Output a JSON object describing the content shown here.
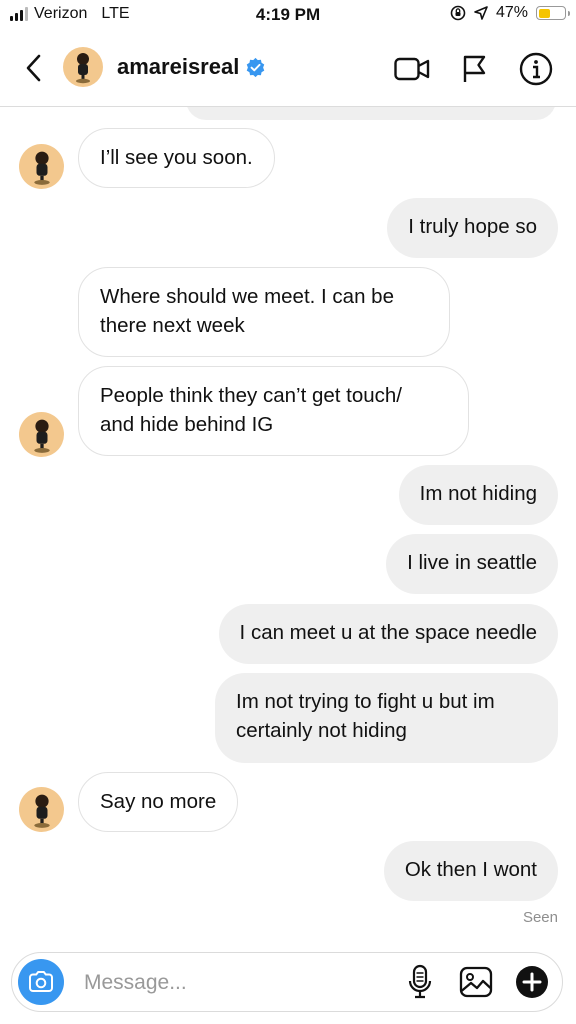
{
  "status_bar": {
    "carrier": "Verizon",
    "network": "LTE",
    "time": "4:19 PM",
    "battery_percent": "47%",
    "battery_level": 0.47,
    "battery_color": "#f5c400"
  },
  "header": {
    "username": "amareisreal",
    "verified": true,
    "verified_color": "#3897f0",
    "icons": [
      "back-chevron-icon",
      "video-call-icon",
      "flag-icon",
      "info-icon"
    ]
  },
  "messages": [
    {
      "direction": "in",
      "text": "I’ll see you soon."
    },
    {
      "direction": "out",
      "text": "I truly hope so"
    },
    {
      "direction": "in",
      "text": "Where should we meet. I can be\nthere next week"
    },
    {
      "direction": "in",
      "text": "People think they can’t get touch/\nand hide behind IG"
    },
    {
      "direction": "out",
      "text": "Im not hiding"
    },
    {
      "direction": "out",
      "text": "I live in seattle"
    },
    {
      "direction": "out",
      "text": "I can meet u at the space needle"
    },
    {
      "direction": "out",
      "text": "Im not trying to fight u but im\ncertainly not hiding"
    },
    {
      "direction": "in",
      "text": "Say no more"
    },
    {
      "direction": "out",
      "text": "Ok then I wont"
    }
  ],
  "seen_label": "Seen",
  "composer": {
    "placeholder": "Message...",
    "camera_color": "#3897f0",
    "icons": [
      "camera-icon",
      "microphone-icon",
      "gallery-icon",
      "plus-icon"
    ]
  }
}
